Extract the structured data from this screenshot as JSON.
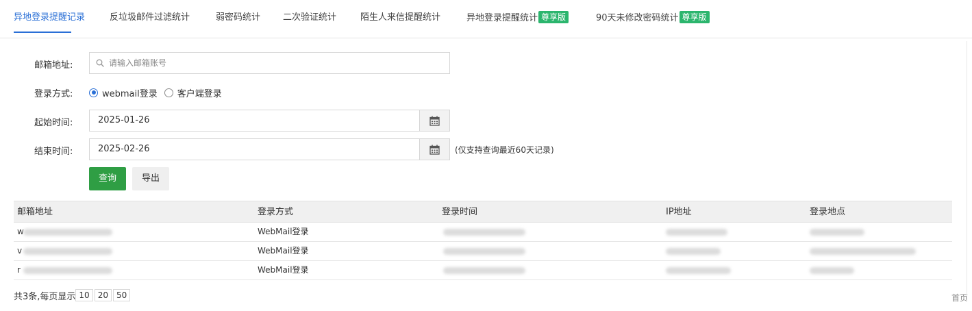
{
  "tabs": [
    {
      "label": "异地登录提醒记录",
      "badge": ""
    },
    {
      "label": "反垃圾邮件过滤统计",
      "badge": ""
    },
    {
      "label": "弱密码统计",
      "badge": ""
    },
    {
      "label": "二次验证统计",
      "badge": ""
    },
    {
      "label": "陌生人来信提醒统计",
      "badge": ""
    },
    {
      "label": "异地登录提醒统计",
      "badge": "尊享版"
    },
    {
      "label": "90天未修改密码统计",
      "badge": "尊享版"
    }
  ],
  "form": {
    "email_label": "邮箱地址:",
    "email_placeholder": "请输入邮箱账号",
    "login_method_label": "登录方式:",
    "login_options": [
      "webmail登录",
      "客户端登录"
    ],
    "login_selected": "webmail登录",
    "start_label": "起始时间:",
    "start_value": "2025-01-26",
    "end_label": "结束时间:",
    "end_value": "2025-02-26",
    "hint": "(仅支持查询最近60天记录)",
    "query_button": "查询",
    "export_button": "导出"
  },
  "table": {
    "columns": [
      "邮箱地址",
      "登录方式",
      "登录时间",
      "IP地址",
      "登录地点"
    ],
    "rows": [
      {
        "email_prefix": "w",
        "method": "WebMail登录"
      },
      {
        "email_prefix": "v",
        "method": "WebMail登录"
      },
      {
        "email_prefix": "r",
        "method": "WebMail登录"
      }
    ]
  },
  "pagination": {
    "summary": "共3条,每页显示",
    "page_sizes": [
      "10",
      "20",
      "50"
    ],
    "first": "首页"
  },
  "colors": {
    "accent": "#2a6fd6",
    "badge": "#2bb56d",
    "query_button": "#2f9e44"
  }
}
